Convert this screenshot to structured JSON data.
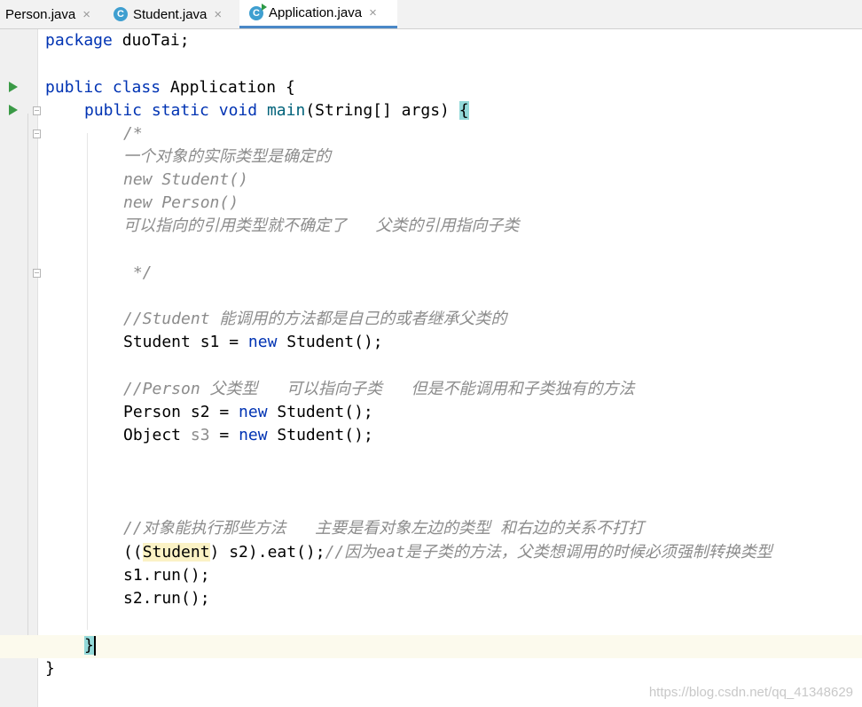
{
  "tabs": [
    {
      "label": "Person.java",
      "close": "×",
      "icon": "java-class-icon"
    },
    {
      "label": "Student.java",
      "close": "×",
      "icon": "java-class-icon"
    },
    {
      "label": "Application.java",
      "close": "×",
      "icon": "java-runnable-class-icon",
      "active": true
    }
  ],
  "tab_icon_glyph": "C",
  "code": {
    "l1_kw": "package",
    "l1_rest": " duoTai;",
    "l3_kw1": "public",
    "l3_kw2": "class",
    "l3_rest": " Application {",
    "l4_kw1": "public",
    "l4_kw2": "static",
    "l4_kw3": "void",
    "l4_fn": "main",
    "l4_rest": "(String[] args) ",
    "l4_brace": "{",
    "c1": "/*",
    "c2": "一个对象的实际类型是确定的",
    "c3": "new Student()",
    "c4": "new Person()",
    "c5": "可以指向的引用类型就不确定了   父类的引用指向子类",
    "c6": " */",
    "c7": "//Student 能调用的方法都是自己的或者继承父类的",
    "s1_a": "Student s1 = ",
    "s1_kw": "new",
    "s1_b": " Student();",
    "c8": "//Person 父类型   可以指向子类   但是不能调用和子类独有的方法",
    "s2_a": "Person s2 = ",
    "s2_kw": "new",
    "s2_b": " Student();",
    "s3_a": "Object ",
    "s3_var": "s3",
    "s3_b": " = ",
    "s3_kw": "new",
    "s3_c": " Student();",
    "c9": "//对象能执行那些方法   主要是看对象左边的类型 和右边的关系不打打",
    "e_open": "((",
    "e_cast": "Student",
    "e_rest": ") s2).eat();",
    "e_comment": "//因为eat是子类的方法，父类想调用的时候必须强制转换类型",
    "run1": "s1.run();",
    "run2": "s2.run();",
    "close_method": "}",
    "close_class": "}"
  },
  "colors": {
    "keyword": "#0033b3",
    "comment": "#8c8c8c",
    "method": "#00627a",
    "active_tab": "#4a88c7"
  },
  "watermark": "https://blog.csdn.net/qq_41348629"
}
